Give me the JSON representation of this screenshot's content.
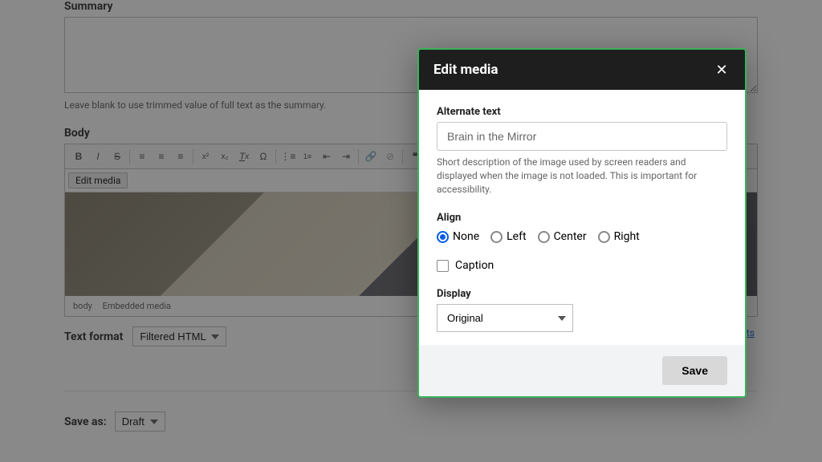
{
  "summary": {
    "label": "Summary",
    "value": "",
    "help": "Leave blank to use trimmed value of full text as the summary."
  },
  "body": {
    "label": "Body",
    "edit_media_label": "Edit media",
    "path": {
      "root": "body",
      "child": "Embedded media"
    }
  },
  "text_format": {
    "label": "Text format",
    "selected": "Filtered HTML",
    "link_fragment": "ats"
  },
  "save_as": {
    "label": "Save as:",
    "selected": "Draft"
  },
  "modal": {
    "title": "Edit media",
    "alt": {
      "label": "Alternate text",
      "value": "Brain in the Mirror",
      "hint": "Short description of the image used by screen readers and displayed when the image is not loaded. This is important for accessibility."
    },
    "align": {
      "label": "Align",
      "options": {
        "none": "None",
        "left": "Left",
        "center": "Center",
        "right": "Right"
      },
      "selected": "none"
    },
    "caption": {
      "label": "Caption",
      "checked": false
    },
    "display": {
      "label": "Display",
      "selected": "Original"
    },
    "save_label": "Save"
  }
}
